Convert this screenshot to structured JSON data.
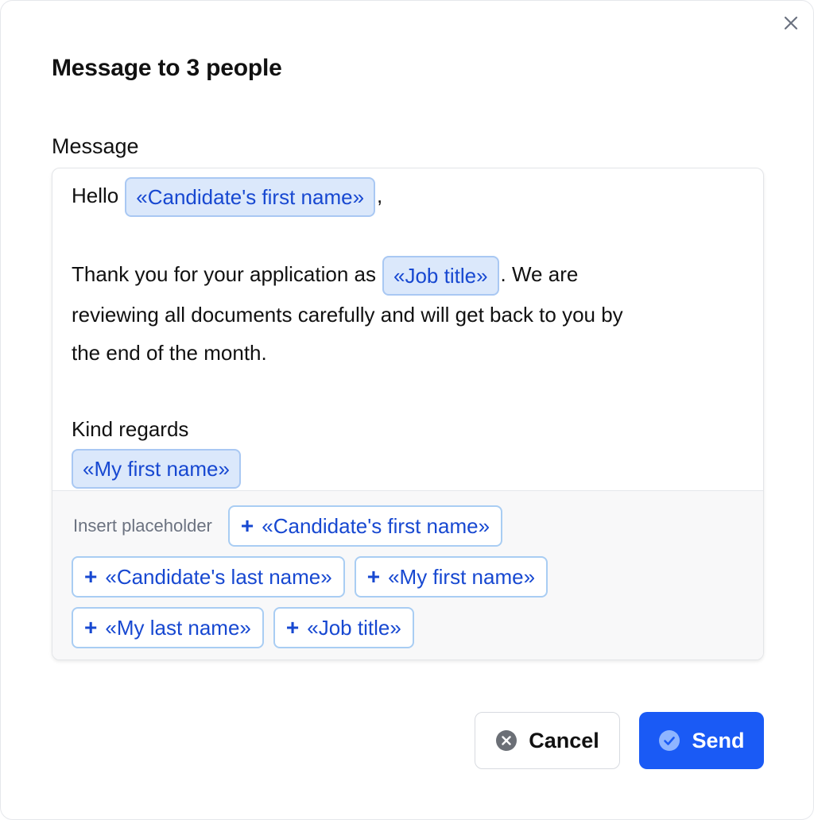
{
  "dialog": {
    "title": "Message to 3 people",
    "close_icon": "close-icon"
  },
  "message": {
    "label": "Message",
    "greeting": "Hello",
    "greeting_placeholder": "«Candidate's first name»",
    "greeting_suffix": ",",
    "body_before": "Thank you for your application as",
    "body_placeholder": "«Job title»",
    "body_after_line1": ". We are",
    "body_line2": "reviewing all documents carefully and will get back to you by",
    "body_line3": "the end of the month.",
    "closing": "Kind regards",
    "signature_placeholder": "«My first name»"
  },
  "placeholders": {
    "label": "Insert placeholder",
    "plus_icon": "plus-icon",
    "items": [
      "«Candidate's first name»",
      "«Candidate's last name»",
      "«My first name»",
      "«My last name»",
      "«Job title»"
    ]
  },
  "actions": {
    "cancel_label": "Cancel",
    "cancel_icon": "x-circle-icon",
    "send_label": "Send",
    "send_icon": "check-circle-icon",
    "send_color": "#1a5af5"
  },
  "colors": {
    "placeholder_text": "#1748d1",
    "placeholder_bg": "#dbe8fb",
    "placeholder_border": "#a9c8f3"
  }
}
